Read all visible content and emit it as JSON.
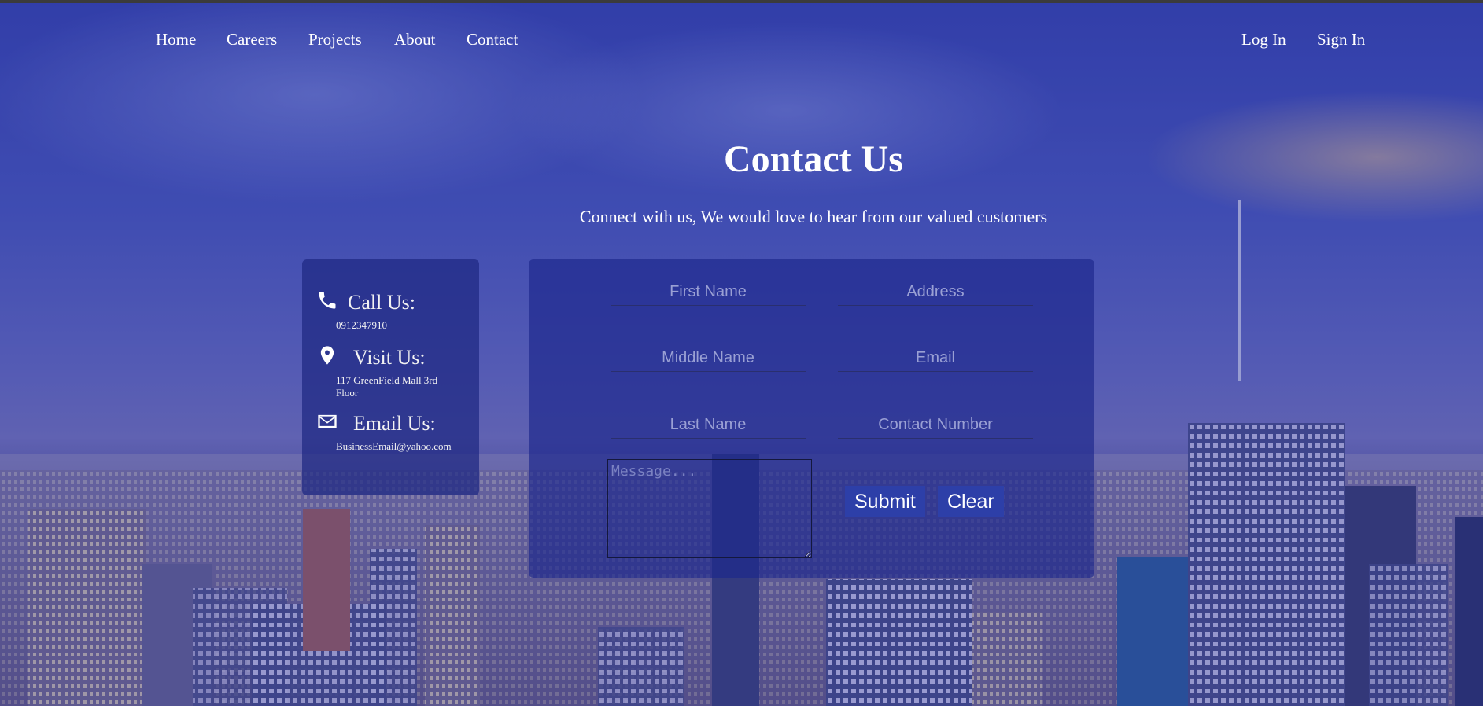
{
  "nav": {
    "left_items": [
      "Home",
      "Careers",
      "Projects",
      "About",
      "Contact"
    ],
    "right_items": [
      "Log In",
      "Sign In"
    ]
  },
  "hero": {
    "title": "Contact Us",
    "subtitle": "Connect with us, We would love to hear from our valued customers"
  },
  "info": {
    "call_label": "Call Us:",
    "call_value": "0912347910",
    "visit_label": "Visit Us:",
    "visit_value": "117 GreenField Mall 3rd Floor",
    "email_label": "Email Us:",
    "email_value": "BusinessEmail@yahoo.com"
  },
  "form": {
    "first_name_placeholder": "First Name",
    "middle_name_placeholder": "Middle Name",
    "last_name_placeholder": "Last Name",
    "address_placeholder": "Address",
    "email_placeholder": "Email",
    "contact_number_placeholder": "Contact Number",
    "message_placeholder": "Message...",
    "submit_label": "Submit",
    "clear_label": "Clear"
  },
  "colors": {
    "overlay": "#1e2896",
    "card": "#1e2882",
    "button": "#2d3fa8",
    "text": "#ffffff"
  }
}
